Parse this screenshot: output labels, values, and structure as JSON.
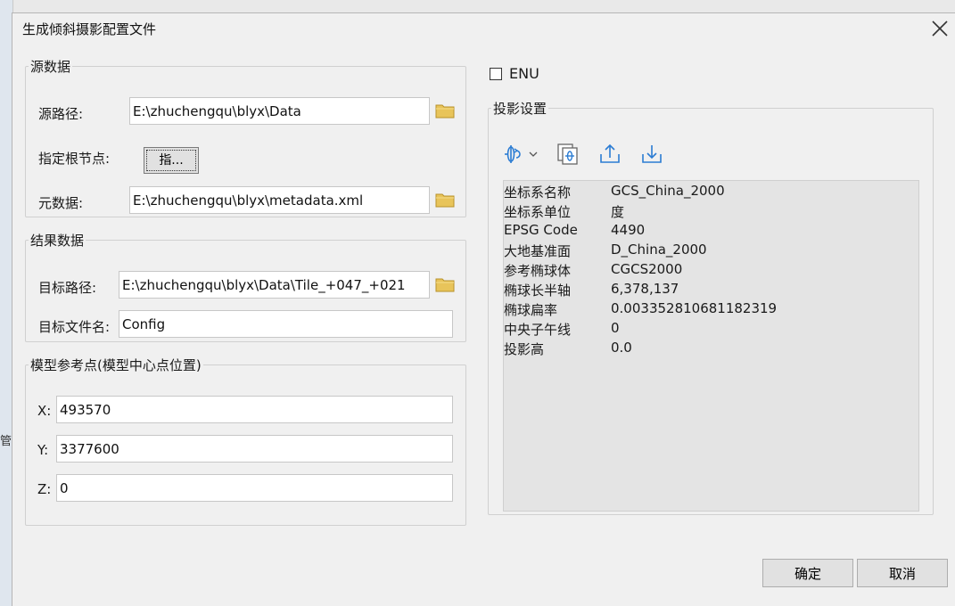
{
  "dialog": {
    "title": "生成倾斜摄影配置文件"
  },
  "background_fragment": "管",
  "source": {
    "legend": "源数据",
    "path_label": "源路径:",
    "path_value": "E:\\zhuchengqu\\blyx\\Data",
    "root_label": "指定根节点:",
    "root_button": "指...",
    "meta_label": "元数据:",
    "meta_value": "E:\\zhuchengqu\\blyx\\metadata.xml"
  },
  "result": {
    "legend": "结果数据",
    "target_path_label": "目标路径:",
    "target_path_value": "E:\\zhuchengqu\\blyx\\Data\\Tile_+047_+021",
    "target_file_label": "目标文件名:",
    "target_file_value": "Config"
  },
  "ref_point": {
    "legend": "模型参考点(模型中心点位置)",
    "x_label": "X:",
    "x_value": "493570",
    "y_label": "Y:",
    "y_value": "3377600",
    "z_label": "Z:",
    "z_value": "0"
  },
  "enu": {
    "label": "ENU",
    "checked": false
  },
  "projection": {
    "legend": "投影设置",
    "toolbar_icons": [
      "coordinate-system-icon",
      "chevron-down-icon",
      "import-projection-icon",
      "export-up-icon",
      "import-down-icon"
    ],
    "properties": [
      {
        "key": "坐标系名称",
        "value": "GCS_China_2000"
      },
      {
        "key": "坐标系单位",
        "value": "度"
      },
      {
        "key": "EPSG Code",
        "value": "4490"
      },
      {
        "key": "大地基准面",
        "value": "D_China_2000"
      },
      {
        "key": "参考椭球体",
        "value": "CGCS2000"
      },
      {
        "key": "椭球长半轴",
        "value": "6,378,137"
      },
      {
        "key": "椭球扁率",
        "value": "0.003352810681182319"
      },
      {
        "key": "中央子午线",
        "value": "0"
      },
      {
        "key": "投影高",
        "value": "0.0"
      }
    ]
  },
  "buttons": {
    "ok": "确定",
    "cancel": "取消"
  },
  "colors": {
    "folder": "#e8c45a",
    "icon_blue": "#2b7cd3",
    "panel_bg": "#e4e4e4"
  }
}
